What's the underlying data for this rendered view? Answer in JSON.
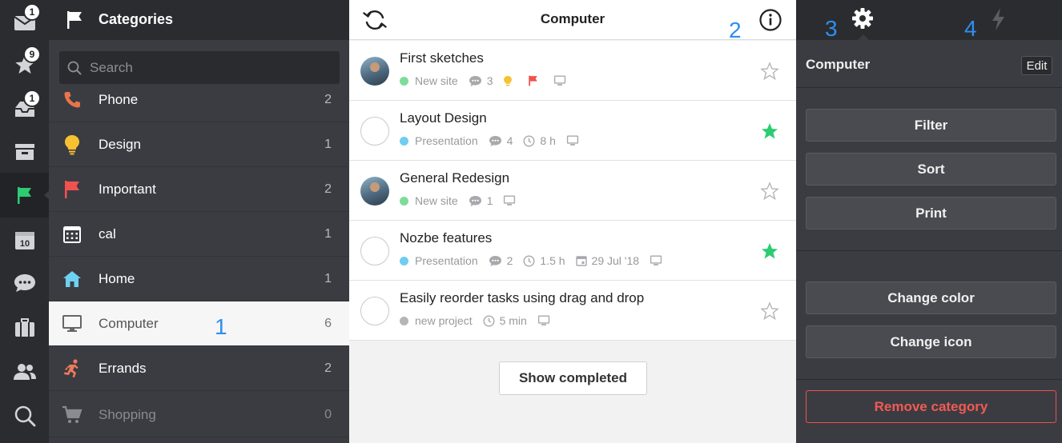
{
  "rail": {
    "items": [
      {
        "name": "inbox",
        "badge": "1"
      },
      {
        "name": "priority",
        "badge": "9"
      },
      {
        "name": "incoming",
        "badge": "1"
      },
      {
        "name": "projects",
        "badge": ""
      },
      {
        "name": "categories",
        "badge": ""
      },
      {
        "name": "calendar",
        "badge": "",
        "calendar_day": "10"
      },
      {
        "name": "comments",
        "badge": ""
      },
      {
        "name": "templates",
        "badge": ""
      },
      {
        "name": "team",
        "badge": ""
      },
      {
        "name": "search",
        "badge": ""
      }
    ]
  },
  "categories": {
    "title": "Categories",
    "search_placeholder": "Search",
    "items": [
      {
        "label": "Phone",
        "count": "2",
        "color": "#e8744a"
      },
      {
        "label": "Design",
        "count": "1",
        "color": "#f6c232"
      },
      {
        "label": "Important",
        "count": "2",
        "color": "#f1524f"
      },
      {
        "label": "cal",
        "count": "1",
        "color": "#ffffff"
      },
      {
        "label": "Home",
        "count": "1",
        "color": "#6fd1f2"
      },
      {
        "label": "Computer",
        "count": "6",
        "color": "#666666"
      },
      {
        "label": "Errands",
        "count": "2",
        "color": "#f07a5a"
      },
      {
        "label": "Shopping",
        "count": "0",
        "color": "#8a8b8f"
      }
    ]
  },
  "tasks": {
    "title": "Computer",
    "items": [
      {
        "name": "First sketches",
        "project": "New site",
        "project_color": "#7ddc9a",
        "comments": "3",
        "starred": false,
        "has_avatar": true
      },
      {
        "name": "Layout Design",
        "project": "Presentation",
        "project_color": "#6fcdf0",
        "comments": "4",
        "time": "8 h",
        "starred": true,
        "has_avatar": false
      },
      {
        "name": "General Redesign",
        "project": "New site",
        "project_color": "#7ddc9a",
        "comments": "1",
        "starred": false,
        "has_avatar": true
      },
      {
        "name": "Nozbe features",
        "project": "Presentation",
        "project_color": "#6fcdf0",
        "comments": "2",
        "time": "1.5 h",
        "date": "29 Jul '18",
        "starred": true,
        "has_avatar": false
      },
      {
        "name": "Easily reorder tasks using drag and drop",
        "project": "new project",
        "project_color": "#b5b5b8",
        "time": "5 min",
        "starred": false,
        "has_avatar": false
      }
    ],
    "show_completed_label": "Show completed"
  },
  "right_panel": {
    "title": "Computer",
    "edit_label": "Edit",
    "buttons": {
      "filter": "Filter",
      "sort": "Sort",
      "print": "Print",
      "change_color": "Change color",
      "change_icon": "Change icon",
      "remove": "Remove category"
    }
  },
  "annotations": [
    "1",
    "2",
    "3",
    "4"
  ],
  "colors": {
    "accent_green": "#2ecc71",
    "annotation_blue": "#2d8ff0",
    "danger_red": "#f25a54"
  }
}
